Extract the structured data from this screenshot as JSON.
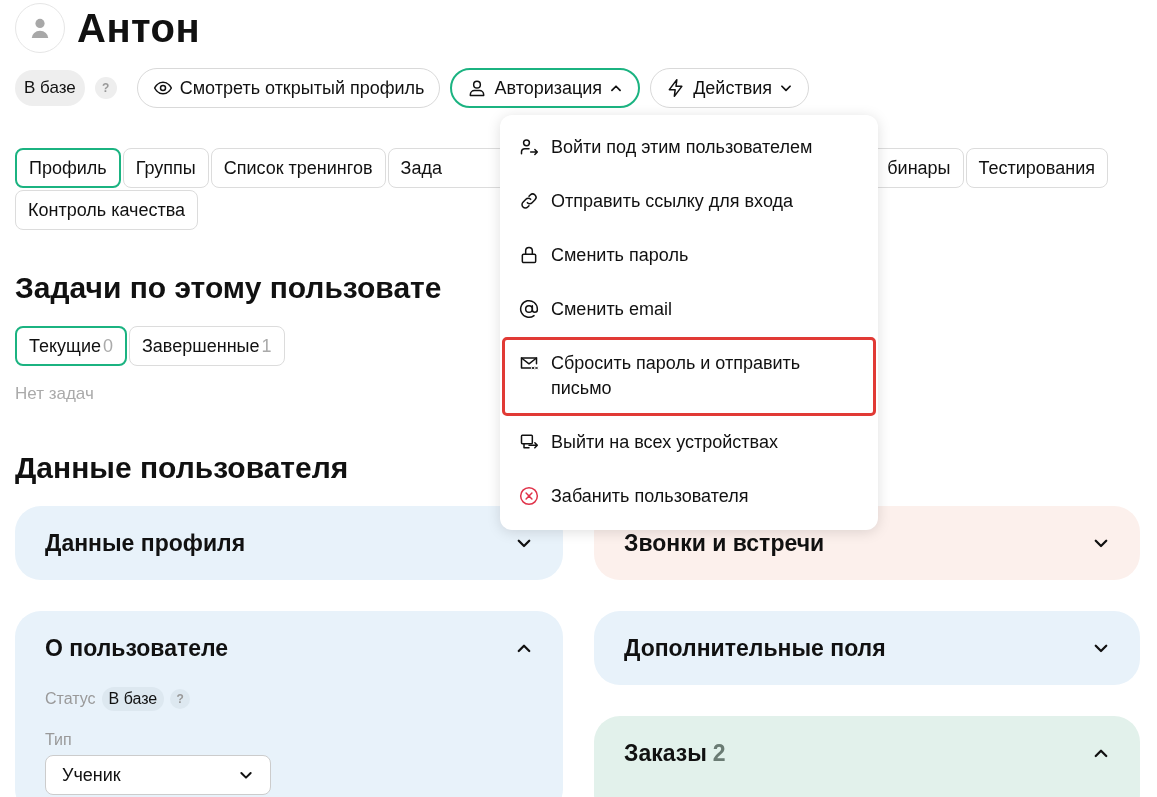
{
  "user": {
    "name": "Антон"
  },
  "status": {
    "label": "В базе",
    "help": "?"
  },
  "actions": [
    {
      "label": "Смотреть открытый профиль",
      "selected": false
    },
    {
      "label": "Авторизация",
      "selected": true
    },
    {
      "label": "Действия",
      "selected": false
    }
  ],
  "auth_menu": [
    {
      "label": "Войти под этим пользователем",
      "highlighted": false
    },
    {
      "label": "Отправить ссылку для входа",
      "highlighted": false
    },
    {
      "label": "Сменить пароль",
      "highlighted": false
    },
    {
      "label": "Сменить email",
      "highlighted": false
    },
    {
      "label": "Сбросить пароль и отправить письмо",
      "highlighted": true
    },
    {
      "label": "Выйти на всех устройствах",
      "highlighted": false
    },
    {
      "label": "Забанить пользователя",
      "highlighted": false
    }
  ],
  "tabs": [
    {
      "label": "Профиль",
      "selected": true
    },
    {
      "label": "Группы",
      "selected": false
    },
    {
      "label": "Список тренингов",
      "selected": false
    },
    {
      "label": "Зада",
      "selected": false
    },
    {
      "label": "бинары",
      "selected": false
    },
    {
      "label": "Тестирования",
      "selected": false
    },
    {
      "label": "Контроль качества",
      "selected": false
    }
  ],
  "tasks": {
    "title": "Задачи по этому пользовате",
    "tabs": [
      {
        "label": "Текущие",
        "count": "0",
        "selected": true
      },
      {
        "label": "Завершенные",
        "count": "1",
        "selected": false
      }
    ],
    "empty": "Нет задач"
  },
  "user_data": {
    "title": "Данные пользователя",
    "left": [
      {
        "title": "Данные профиля",
        "expanded": false,
        "color": "#e8f2fa"
      },
      {
        "title": "О пользователе",
        "expanded": true,
        "color": "#e8f2fa",
        "status_label": "Статус",
        "status": "В базе",
        "help": "?",
        "type_label": "Тип",
        "type": "Ученик"
      }
    ],
    "right": [
      {
        "title": "Звонки и встречи",
        "expanded": false,
        "color": "#fcf0ec"
      },
      {
        "title": "Дополнительные поля",
        "expanded": false,
        "color": "#e8f2fa"
      },
      {
        "title": "Заказы",
        "count": "2",
        "expanded": true,
        "color": "#e2f1eb"
      }
    ]
  }
}
